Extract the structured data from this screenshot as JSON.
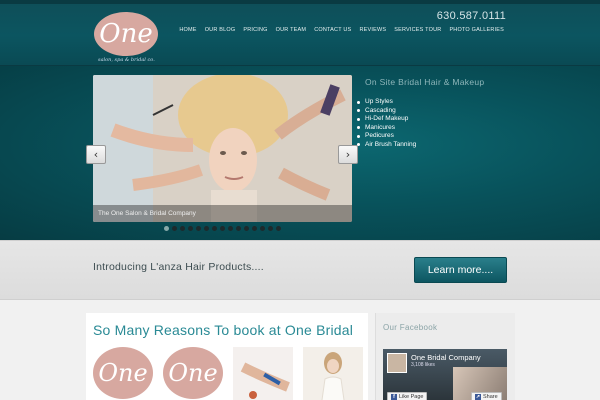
{
  "header": {
    "logo_text": "One",
    "logo_tagline": "salon, spa & bridal co.",
    "phone": "630.587.0111",
    "nav": [
      "HOME",
      "OUR BLOG",
      "PRICING",
      "OUR TEAM",
      "CONTACT US",
      "REVIEWS",
      "SERVICES TOUR",
      "PHOTO GALLERIES"
    ]
  },
  "hero": {
    "slide_caption": "The One Salon & Bridal Company",
    "prev_label": "‹",
    "next_label": "›",
    "title": "On Site Bridal Hair & Makeup",
    "services": [
      "Up Styles",
      "Cascading",
      "Hi-Def Makeup",
      "Manicures",
      "Pedicures",
      "Air Brush Tanning"
    ],
    "dot_count": 15,
    "active_dot": 0
  },
  "promo": {
    "text": "Introducing L'anza Hair Products....",
    "button": "Learn more...."
  },
  "main": {
    "title": "So Many Reasons To book at One Bridal",
    "thumb_logo_text": "One"
  },
  "sidebar": {
    "title": "Our Facebook",
    "fb_name": "One Bridal Company",
    "fb_likes": "3,108 likes",
    "like_label": "Like Page",
    "share_label": "Share"
  },
  "colors": {
    "header_bg": "#0b5560",
    "accent": "#2a8a95",
    "logo_pink": "#d7a8a0",
    "button_teal": "#0d5661"
  }
}
